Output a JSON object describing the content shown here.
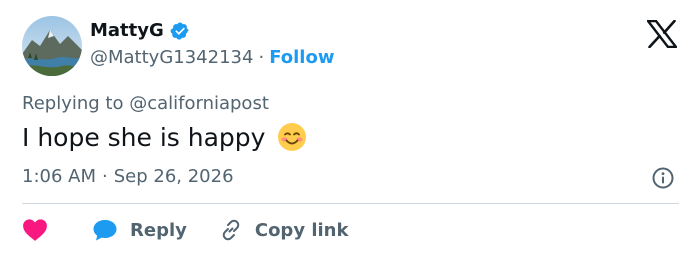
{
  "author": {
    "display_name": "MattyG",
    "handle": "@MattyG1342134",
    "verified": true,
    "follow_label": "Follow",
    "separator": "·"
  },
  "reply_context": {
    "prefix": "Replying to ",
    "target": "@californiapost"
  },
  "tweet": {
    "text": "I hope she is happy",
    "emoji": "smiling-face-with-smiling-eyes"
  },
  "meta": {
    "time": "1:06 AM",
    "separator": "·",
    "date": "Sep 26, 2026"
  },
  "actions": {
    "reply_label": "Reply",
    "copy_link_label": "Copy link"
  },
  "icons": {
    "brand": "x-logo-icon",
    "verified": "verified-badge-icon",
    "info": "info-icon",
    "like": "heart-icon",
    "reply": "speech-bubble-icon",
    "copy": "link-icon"
  },
  "colors": {
    "text": "#0f1419",
    "secondary": "#536471",
    "accent": "#1d9bf0",
    "like": "#f91880",
    "divider": "#cfd9de"
  }
}
